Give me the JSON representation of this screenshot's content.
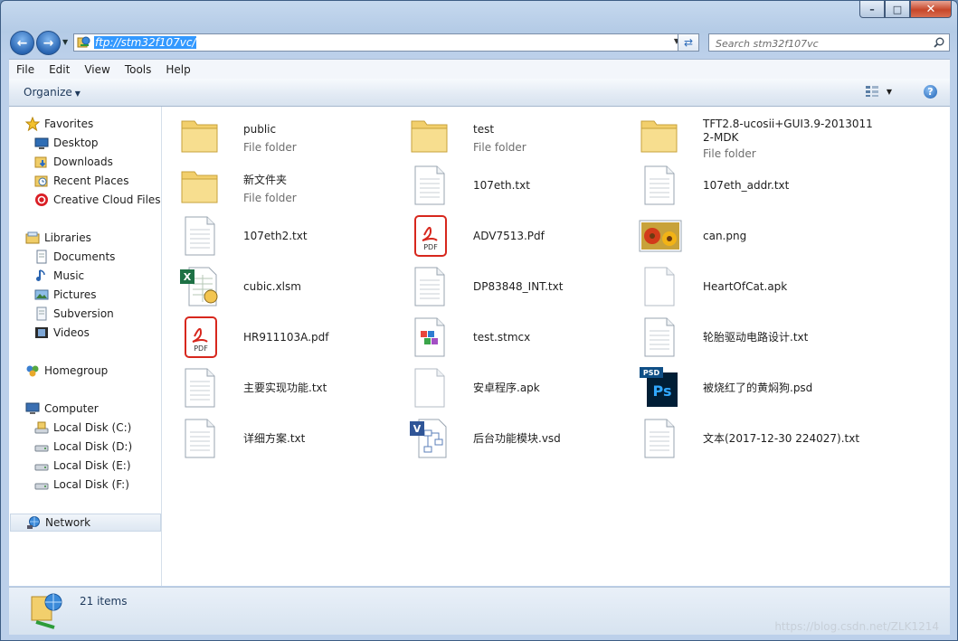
{
  "window": {
    "address": "ftp://stm32f107vc/",
    "search_placeholder": "Search stm32f107vc",
    "caption": {
      "minimize": "–",
      "maximize": "□",
      "close": "✕"
    }
  },
  "menu": [
    "File",
    "Edit",
    "View",
    "Tools",
    "Help"
  ],
  "toolbar": {
    "organize": "Organize",
    "help": "?"
  },
  "nav": {
    "favorites": {
      "label": "Favorites",
      "items": [
        "Desktop",
        "Downloads",
        "Recent Places",
        "Creative Cloud Files"
      ]
    },
    "libraries": {
      "label": "Libraries",
      "items": [
        "Documents",
        "Music",
        "Pictures",
        "Subversion",
        "Videos"
      ]
    },
    "homegroup": "Homegroup",
    "computer": {
      "label": "Computer",
      "items": [
        "Local Disk (C:)",
        "Local Disk (D:)",
        "Local Disk (E:)",
        "Local Disk (F:)"
      ]
    },
    "network": "Network"
  },
  "files": [
    {
      "name": "public",
      "type": "File folder",
      "icon": "folder-icon"
    },
    {
      "name": "test",
      "type": "File folder",
      "icon": "folder-icon"
    },
    {
      "name": "TFT2.8-ucosii+GUI3.9-20130112-MDK",
      "type": "File folder",
      "icon": "folder-icon"
    },
    {
      "name": "新文件夹",
      "type": "File folder",
      "icon": "folder-icon"
    },
    {
      "name": "107eth.txt",
      "icon": "text-file-icon"
    },
    {
      "name": "107eth_addr.txt",
      "icon": "text-file-icon"
    },
    {
      "name": "107eth2.txt",
      "icon": "text-file-icon"
    },
    {
      "name": "ADV7513.Pdf",
      "icon": "pdf-icon"
    },
    {
      "name": "can.png",
      "icon": "image-file-icon"
    },
    {
      "name": "cubic.xlsm",
      "icon": "excel-icon"
    },
    {
      "name": "DP83848_INT.txt",
      "icon": "text-file-icon"
    },
    {
      "name": "HeartOfCat.apk",
      "icon": "blank-file-icon"
    },
    {
      "name": "HR911103A.pdf",
      "icon": "pdf-icon"
    },
    {
      "name": "test.stmcx",
      "icon": "stm-cube-file-icon"
    },
    {
      "name": "轮胎驱动电路设计.txt",
      "icon": "text-file-icon"
    },
    {
      "name": "主要实现功能.txt",
      "icon": "text-file-icon"
    },
    {
      "name": "安卓程序.apk",
      "icon": "blank-file-icon"
    },
    {
      "name": "被烧红了的黄焖狗.psd",
      "icon": "photoshop-icon"
    },
    {
      "name": "详细方案.txt",
      "icon": "text-file-icon"
    },
    {
      "name": "后台功能模块.vsd",
      "icon": "visio-icon"
    },
    {
      "name": "文本(2017-12-30 224027).txt",
      "icon": "text-file-icon"
    }
  ],
  "status": {
    "count": "21 items",
    "watermark": "https://blog.csdn.net/ZLK1214"
  },
  "icon_labels": {
    "pdf": "PDF",
    "psd": "PSD",
    "ps": "Ps",
    "visio": "V",
    "excel": "X"
  },
  "colors": {
    "selection": "#3399ff",
    "folder": "#f2cf6c",
    "pdf": "#d7271d",
    "photoshop": "#001e36",
    "excel": "#1e7145",
    "visio": "#2f5597"
  }
}
